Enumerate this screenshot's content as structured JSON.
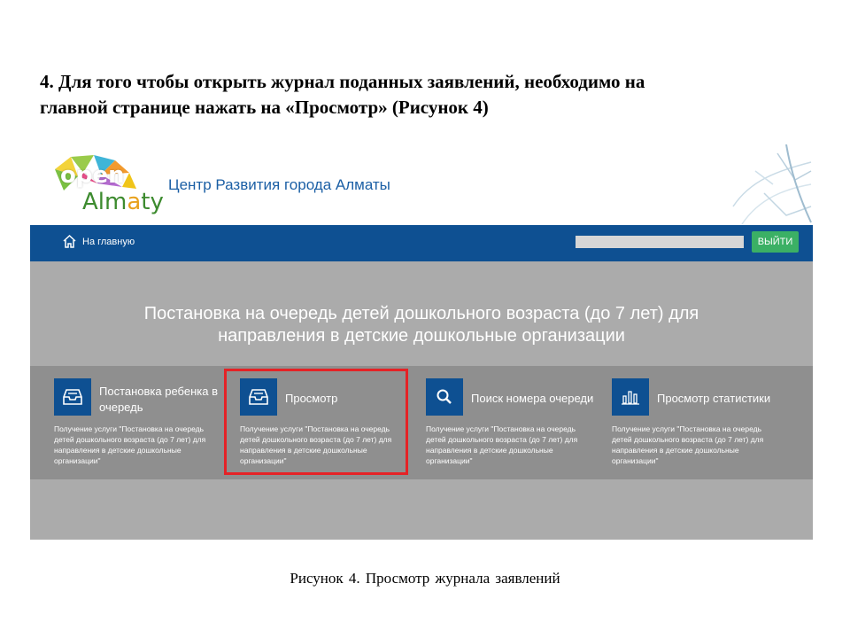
{
  "instruction": {
    "line1": "4. Для того чтобы открыть журнал поданных заявлений, необходимо на",
    "line2": "главной странице нажать на «Просмотр» (Рисунок 4)"
  },
  "site": {
    "logo": {
      "word1": "open",
      "word2_part1": "Alm",
      "word2_accent": "a",
      "word2_part2": "ty"
    },
    "org_title": "Центр Развития города Алматы",
    "nav": {
      "home_label": "На главную",
      "logout_label": "ВЫЙТИ"
    },
    "banner": {
      "line1": "Постановка на очередь детей дошкольного возраста (до 7 лет) для",
      "line2": "направления в детские дошкольные организации"
    },
    "cards": [
      {
        "title": "Постановка ребенка в очередь",
        "icon": "inbox-tray-icon",
        "description": "Получение услуги \"Постановка на очередь детей дошкольного возраста (до 7 лет) для направления в детские дошкольные организации\""
      },
      {
        "title": "Просмотр",
        "icon": "inbox-tray-icon",
        "description": "Получение услуги \"Постановка на очередь детей дошкольного возраста (до 7 лет) для направления в детские дошкольные организации\""
      },
      {
        "title": "Поиск номера очереди",
        "icon": "search-icon",
        "description": "Получение услуги \"Постановка на очередь детей дошкольного возраста (до 7 лет) для направления в детские дошкольные организации\""
      },
      {
        "title": "Просмотр статистики",
        "icon": "bar-chart-icon",
        "description": "Получение услуги \"Постановка на очередь детей дошкольного возраста (до 7 лет) для направления в детские дошкольные организации\""
      }
    ],
    "colors": {
      "nav_bg": "#0e5092",
      "logout_bg": "#3bb065",
      "banner_bg": "#ababab",
      "cards_bg": "#8f8f8f",
      "highlight": "#e52226"
    }
  },
  "caption": "Рисунок 4. Просмотр журнала заявлений"
}
